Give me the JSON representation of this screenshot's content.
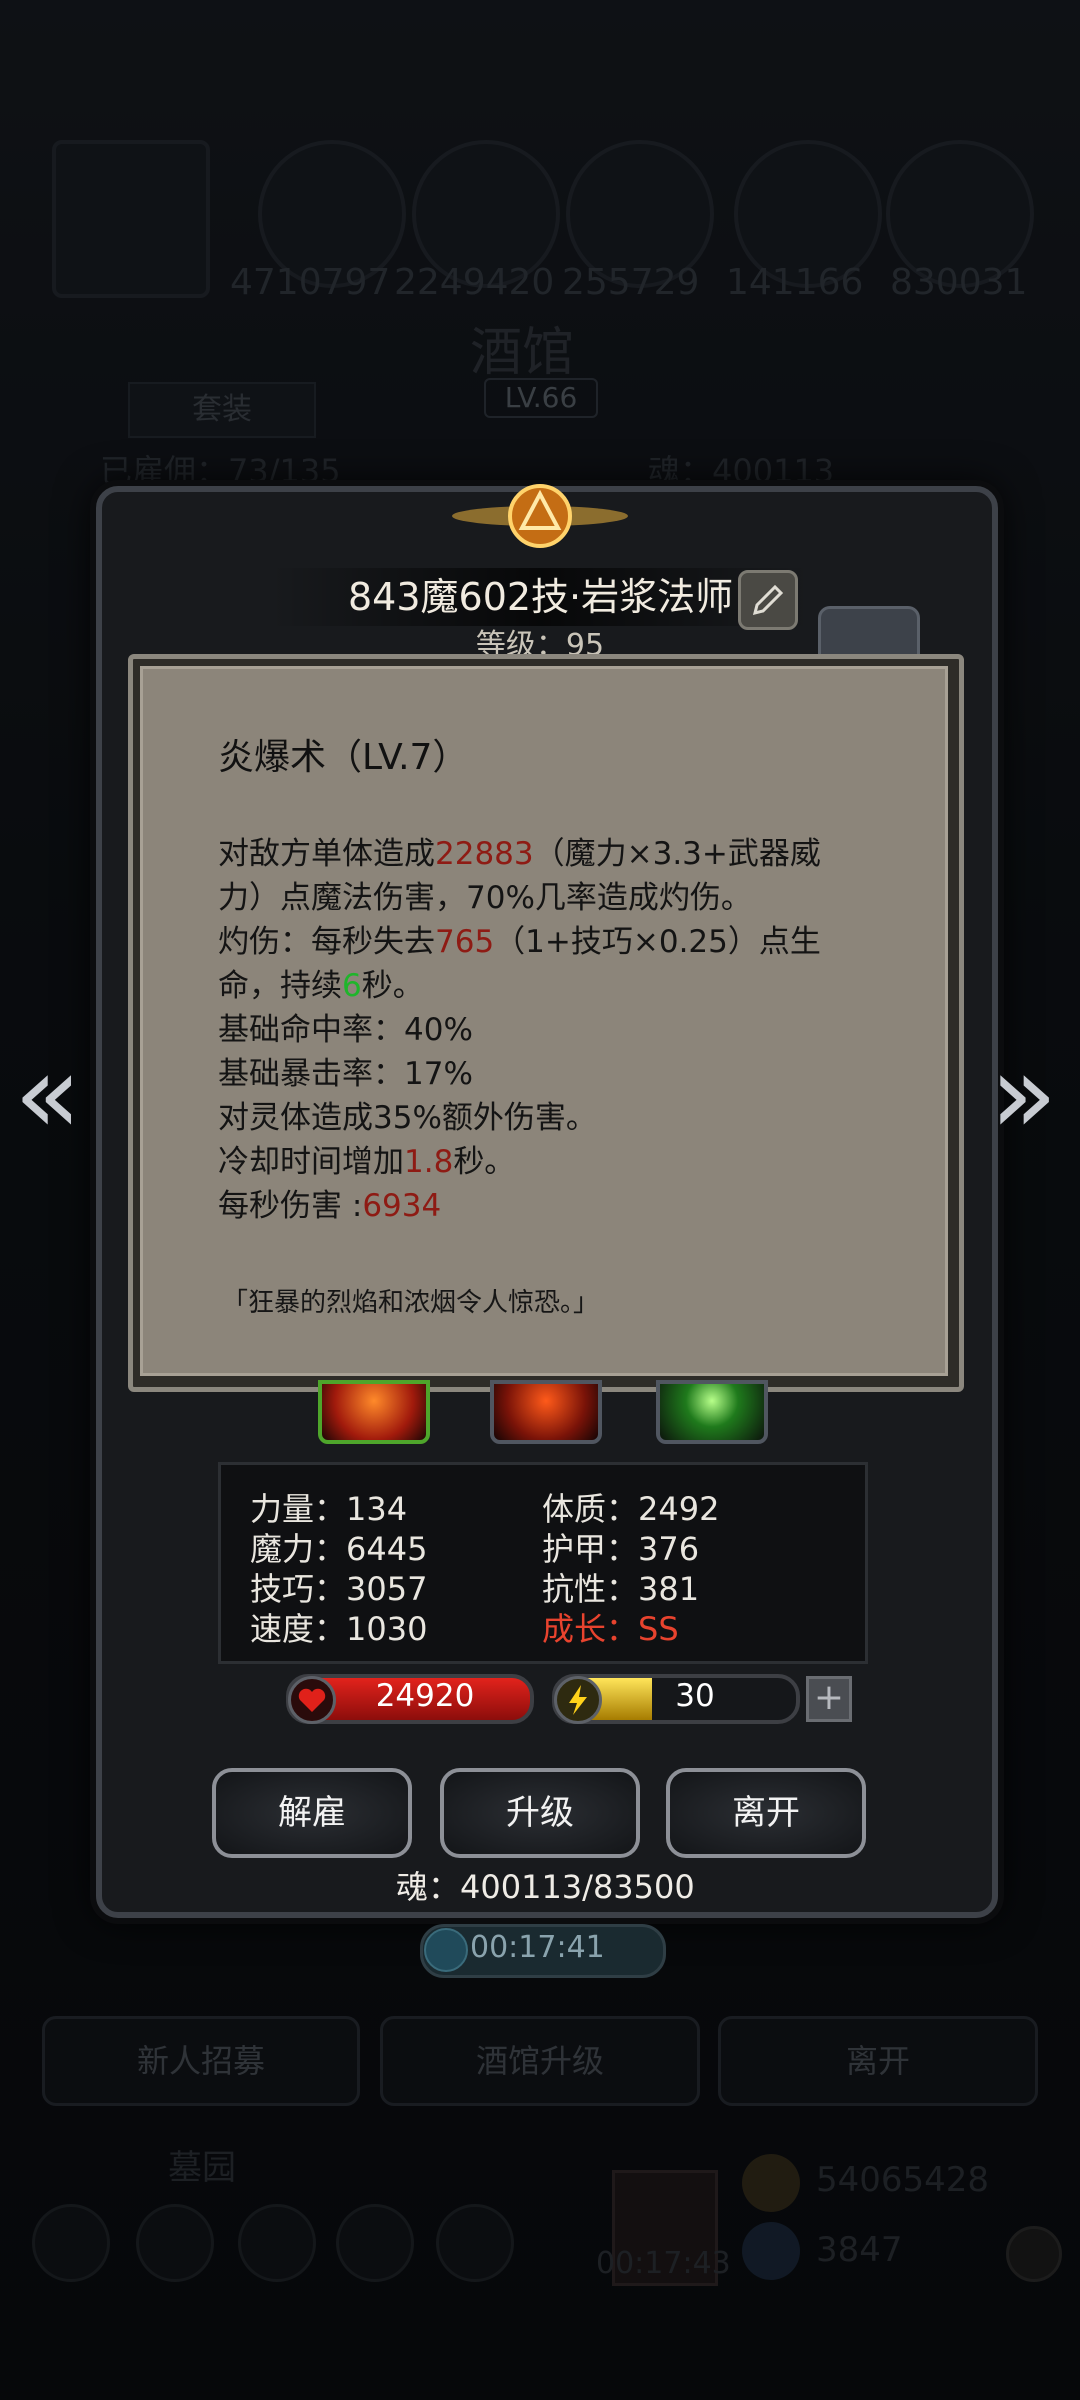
{
  "background": {
    "resources": [
      "4710797",
      "2249420",
      "255729",
      "141166",
      "830031"
    ],
    "tavern_title": "酒馆",
    "tavern_level": "LV.66",
    "tab_suit": "套装",
    "hero_count": "已雇佣：73/135",
    "soul_bg": "魂：400113",
    "bottom_buttons": [
      "新人招募",
      "酒馆升级",
      "离开"
    ],
    "cemetery": "墓园",
    "bottom_timer": "00:17:43",
    "gold": "54065428",
    "gems": "3847"
  },
  "hero": {
    "name": "843魔602技·岩浆法师",
    "level": "等级：95"
  },
  "tooltip": {
    "title": "炎爆术（LV.7）",
    "line1_a": "对敌方单体造成",
    "line1_dmg": "22883",
    "line1_b": "（魔力×3.3+武器威",
    "line2": "力）点魔法伤害，70%几率造成灼伤。",
    "line3_a": "灼伤：每秒失去",
    "line3_val": "765",
    "line3_b": "（1+技巧×0.25）点生",
    "line4_a": "命，持续",
    "line4_val": "6",
    "line4_b": "秒。",
    "line5": "基础命中率：40%",
    "line6": "基础暴击率：17%",
    "line7": "对灵体造成35%额外伤害。",
    "line8_a": "冷却时间增加",
    "line8_val": "1.8",
    "line8_b": "秒。",
    "line9_a": "每秒伤害 :",
    "line9_val": "6934",
    "quote": "「狂暴的烈焰和浓烟令人惊恐。」"
  },
  "skills": [
    "fire-burst-icon",
    "flame-icon",
    "green-orb-icon"
  ],
  "stats": {
    "strength": "力量：134",
    "magic": "魔力：6445",
    "skill": "技巧：3057",
    "speed": "速度：1030",
    "constitution": "体质：2492",
    "armor": "护甲：376",
    "resistance": "抗性：381",
    "growth": "成长：SS"
  },
  "hp": "24920",
  "energy": "30",
  "energy_fraction": 0.4,
  "actions": {
    "dismiss": "解雇",
    "upgrade": "升级",
    "leave": "离开"
  },
  "soul": "魂：400113/83500",
  "timer": "00:17:41",
  "colors": {
    "damage_red": "#8e1b14",
    "duration_green": "#1fb52b",
    "growth_red": "#e8432e",
    "hp_red": "#e2231c",
    "energy_yellow": "#ffe55a"
  }
}
